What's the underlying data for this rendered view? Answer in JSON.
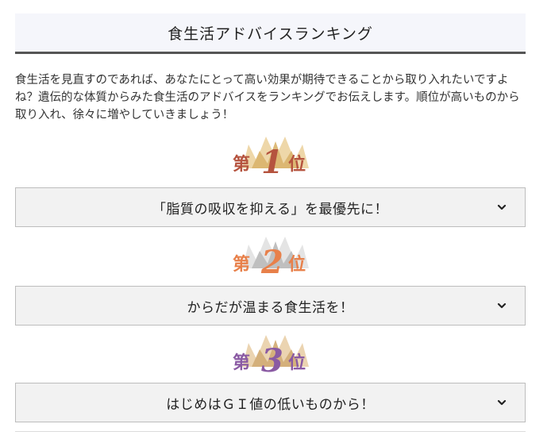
{
  "header": {
    "title": "食生活アドバイスランキング"
  },
  "intro": {
    "text": "食生活を見直すのであれば、あなたにとって高い効果が期待できることから取り入れたいですよね？遺伝的な体質からみた食生活のアドバイスをランキングでお伝えします。順位が高いものから取り入れ、徐々に増やしていきましょう！"
  },
  "rankings": [
    {
      "prefix": "第",
      "number": "1",
      "suffix": "位",
      "color": "#b5533e",
      "crown_colors": [
        "#e8c07a",
        "#cfa24f"
      ],
      "label": "「脂質の吸収を抑える」を最優先に！",
      "icon": "chevron-down-icon"
    },
    {
      "prefix": "第",
      "number": "2",
      "suffix": "位",
      "color": "#e8804a",
      "crown_colors": [
        "#d9d9d9",
        "#b0b0b0"
      ],
      "label": "からだが温まる食生活を！",
      "icon": "chevron-down-icon"
    },
    {
      "prefix": "第",
      "number": "3",
      "suffix": "位",
      "color": "#8a5aa3",
      "crown_colors": [
        "#e3bf8c",
        "#c99d63"
      ],
      "label": "はじめはＧＩ値の低いものから！",
      "icon": "chevron-down-icon"
    }
  ]
}
